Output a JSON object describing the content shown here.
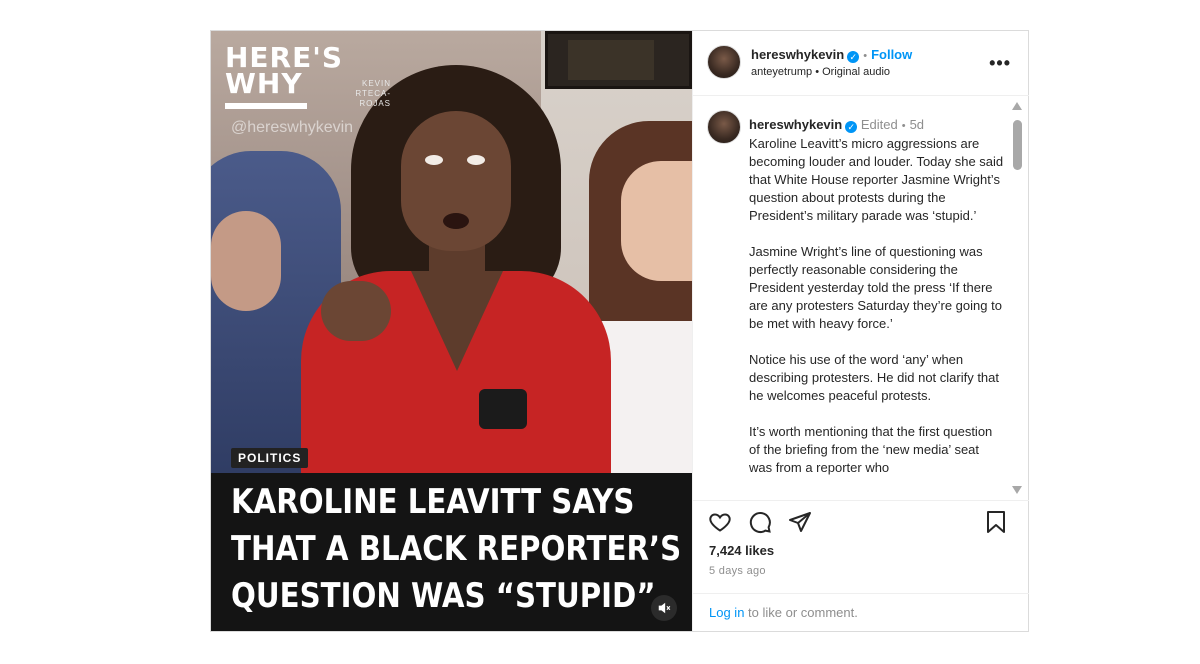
{
  "media": {
    "brand_line1": "HERE'S",
    "brand_line2": "WHY",
    "brand_sub1": "KEVIN",
    "brand_sub2": "RTECA-ROJAS",
    "watermark": "@hereswhykevin",
    "badge": "POLITICS",
    "headline": [
      "KAROLINE LEAVITT SAYS",
      "THAT A BLACK REPORTER’S",
      "QUESTION WAS “STUPID”"
    ],
    "mute_icon": "speaker-muted-icon"
  },
  "header": {
    "username": "hereswhykevin",
    "follow_label": "Follow",
    "audio_user": "anteyetrump",
    "audio_label": "Original audio",
    "more_icon": "more-horizontal-icon"
  },
  "caption": {
    "username": "hereswhykevin",
    "edited": "Edited",
    "age": "5d",
    "paragraphs": [
      "Karoline Leavitt’s micro aggressions are becoming louder and louder. Today she said that White House reporter Jasmine Wright’s question about protests during the President’s military parade was ‘stupid.’",
      "Jasmine Wright’s line of questioning was perfectly reasonable considering the President yesterday told the press ‘If there are any protesters Saturday they’re going to be met with heavy force.’",
      "Notice his use of the word ‘any’ when describing protesters. He did not clarify that he welcomes peaceful protests.",
      "It’s worth mentioning that the first question of the briefing from the ‘new media’ seat was from a reporter who"
    ]
  },
  "actions": {
    "like_icon": "heart-icon",
    "comment_icon": "comment-icon",
    "share_icon": "share-icon",
    "save_icon": "bookmark-icon"
  },
  "stats": {
    "likes": "7,424 likes",
    "time": "5 days ago"
  },
  "footer": {
    "login_link": "Log in",
    "login_rest": " to like or comment."
  },
  "colors": {
    "accent": "#0095f6",
    "muted_text": "#8e8e8e",
    "text": "#262626"
  }
}
